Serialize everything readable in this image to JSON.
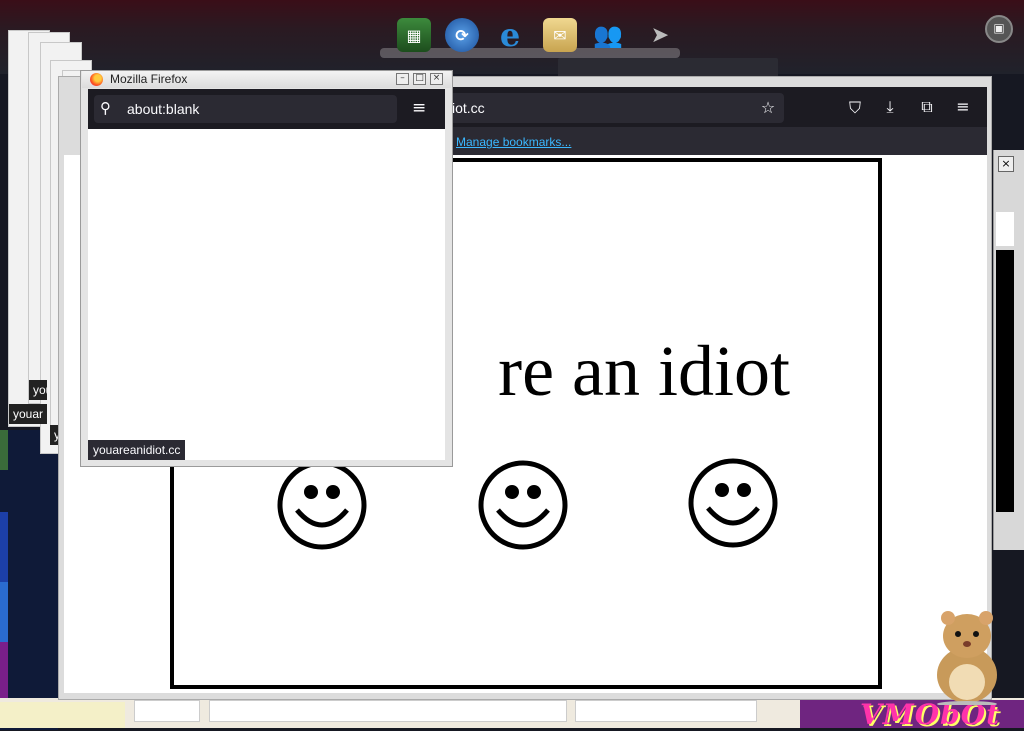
{
  "small_window": {
    "title": "Mozilla Firefox",
    "url": "about:blank",
    "status": "youareanidiot.cc",
    "buttons": {
      "minimize": "–",
      "maximize": "□",
      "close": "×"
    }
  },
  "big_window": {
    "url_fragment": "iot.cc",
    "bookmarks_link": "Manage bookmarks...",
    "page_text": "re an idiot"
  },
  "ghost_labels": [
    "youa",
    "you",
    "youa",
    "you",
    "youar"
  ],
  "dock": {
    "icons": [
      "spreadsheet-icon",
      "globe-update-icon",
      "internet-explorer-icon",
      "mail-icon",
      "users-icon"
    ]
  },
  "right_close": "×",
  "logo_text": "VMObOt"
}
